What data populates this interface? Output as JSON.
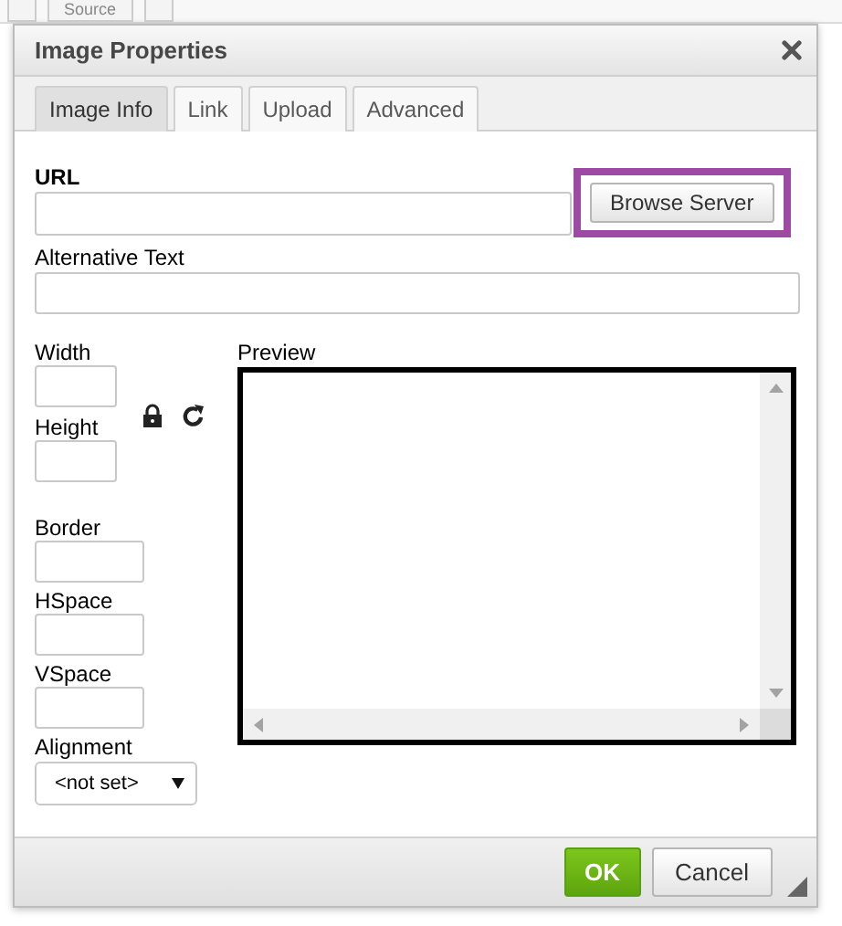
{
  "editor_toolbar": {
    "source_button": "Source"
  },
  "dialog": {
    "title": "Image Properties",
    "tabs": [
      {
        "label": "Image Info",
        "selected": true
      },
      {
        "label": "Link",
        "selected": false
      },
      {
        "label": "Upload",
        "selected": false
      },
      {
        "label": "Advanced",
        "selected": false
      }
    ],
    "url": {
      "label": "URL"
    },
    "browse_button": {
      "label": "Browse Server",
      "highlighted": true
    },
    "alt_text": {
      "label": "Alternative Text"
    },
    "size_fields": [
      {
        "label": "Width"
      },
      {
        "label": "Height"
      }
    ],
    "spacing_fields": [
      {
        "label": "Border"
      },
      {
        "label": "HSpace"
      },
      {
        "label": "VSpace"
      }
    ],
    "alignment": {
      "label": "Alignment",
      "value": "<not set>"
    },
    "preview": {
      "label": "Preview"
    },
    "buttons": [
      {
        "label": "OK",
        "kind": "primary"
      },
      {
        "label": "Cancel",
        "kind": "secondary"
      }
    ]
  }
}
